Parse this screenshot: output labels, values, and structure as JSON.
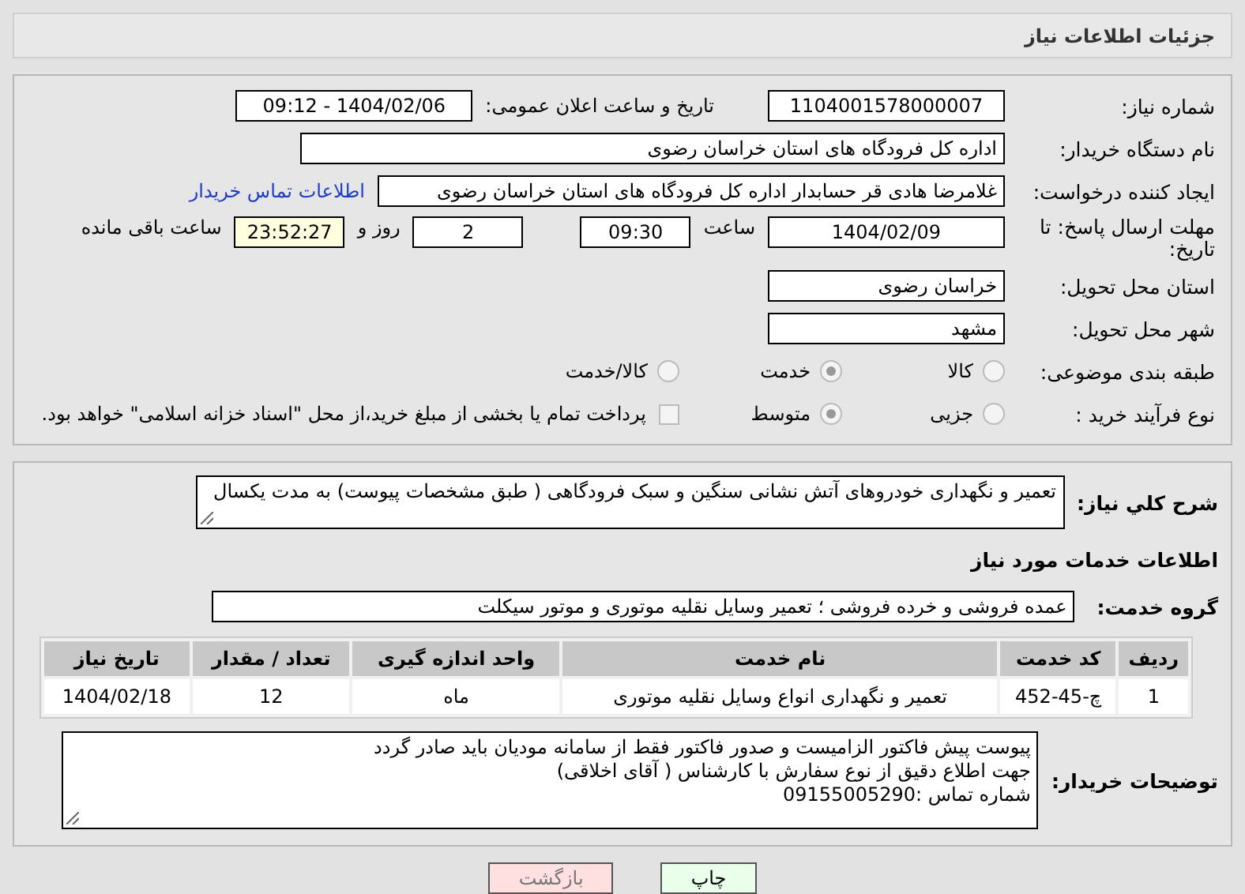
{
  "header": {
    "title": "جزئیات اطلاعات نیاز"
  },
  "need_info": {
    "need_number": {
      "label": "شماره نیاز:",
      "value": "1104001578000007"
    },
    "announce_datetime": {
      "label": "تاریخ و ساعت اعلان عمومی:",
      "value": "1404/02/06 - 09:12"
    },
    "buyer_org": {
      "label": "نام دستگاه خریدار:",
      "value": "اداره کل فرودگاه های استان خراسان رضوی"
    },
    "requester": {
      "label": "ایجاد کننده درخواست:",
      "value": "غلامرضا هادی قر حسابدار اداره کل فرودگاه های استان خراسان رضوی",
      "link": "اطلاعات تماس خریدار"
    },
    "deadline": {
      "label": "مهلت ارسال پاسخ: تا تاریخ:",
      "date": "1404/02/09",
      "time_label": "ساعت",
      "time": "09:30",
      "days": "2",
      "days_label": "روز و",
      "remaining": "23:52:27",
      "remaining_label": "ساعت باقی مانده"
    },
    "province": {
      "label": "استان محل تحویل:",
      "value": "خراسان رضوی"
    },
    "city": {
      "label": "شهر محل تحویل:",
      "value": "مشهد"
    },
    "category": {
      "label": "طبقه بندی موضوعی:",
      "options": [
        {
          "label": "کالا",
          "selected": false
        },
        {
          "label": "خدمت",
          "selected": true
        },
        {
          "label": "کالا/خدمت",
          "selected": false
        }
      ]
    },
    "process": {
      "label": "نوع فرآیند خرید :",
      "options": [
        {
          "label": "جزیی",
          "selected": false
        },
        {
          "label": "متوسط",
          "selected": true
        }
      ],
      "payment": {
        "checked": false,
        "label": "پرداخت تمام یا بخشی از مبلغ خرید،از محل \"اسناد خزانه اسلامی\" خواهد بود."
      }
    }
  },
  "details": {
    "description": {
      "label": "شرح کلي نیاز:",
      "value": "تعمیر و نگهداری خودروهای آتش نشانی سنگین و سبک فرودگاهی ( طبق مشخصات پیوست) به مدت یکسال"
    },
    "services_title": "اطلاعات خدمات مورد نیاز",
    "service_group": {
      "label": "گروه خدمت:",
      "value": "عمده فروشی و خرده فروشی ؛ تعمیر وسایل نقلیه موتوری و موتور سیکلت"
    },
    "table": {
      "columns": [
        "ردیف",
        "کد خدمت",
        "نام خدمت",
        "واحد اندازه گیری",
        "تعداد / مقدار",
        "تاریخ نیاز"
      ],
      "rows": [
        [
          "1",
          "چ-45-452",
          "تعمیر و نگهداری انواع وسایل نقلیه موتوری",
          "ماه",
          "12",
          "1404/02/18"
        ]
      ]
    },
    "buyer_notes": {
      "label": "توضیحات خریدار:",
      "lines": [
        "پیوست پیش فاکتور الزامیست و صدور فاکتور فقط از سامانه مودیان باید صادر گردد",
        "جهت اطلاع دقیق از نوع سفارش با کارشناس  ( آقای اخلاقی)",
        "شماره تماس :09155005290"
      ]
    }
  },
  "buttons": [
    {
      "kind": "print",
      "label": "چاپ"
    },
    {
      "kind": "back",
      "label": "بازگشت"
    }
  ]
}
